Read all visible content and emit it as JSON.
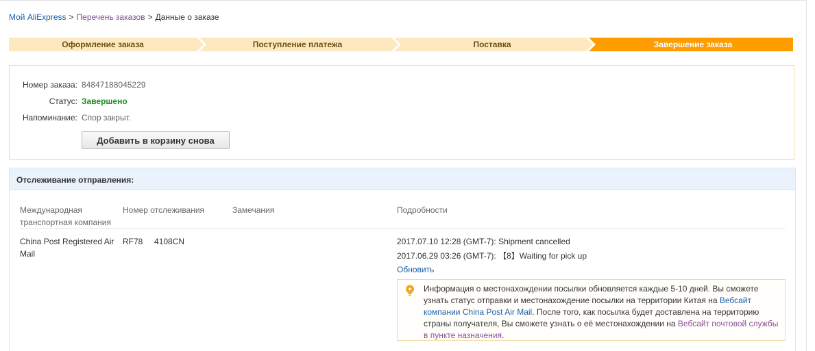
{
  "breadcrumb": {
    "home": "Мой AliExpress",
    "orders": "Перечень заказов",
    "current": "Данные о заказе",
    "separator": ">"
  },
  "steps": [
    {
      "label": "Оформление заказа",
      "active": false
    },
    {
      "label": "Поступление платежа",
      "active": false
    },
    {
      "label": "Поставка",
      "active": false
    },
    {
      "label": "Завершение заказа",
      "active": true
    }
  ],
  "colors": {
    "step_inactive": "#fde8bf",
    "step_active": "#ff9c00",
    "status_green": "#1a8e1f",
    "link_blue": "#1a5ea8",
    "link_purple": "#8a4f9b"
  },
  "order": {
    "number_label": "Номер заказа:",
    "number_value": "84847188045229",
    "status_label": "Статус:",
    "status_value": "Завершено",
    "reminder_label": "Напоминание:",
    "reminder_value": "Спор закрыт.",
    "add_to_cart_label": "Добавить в корзину снова"
  },
  "tracking": {
    "title": "Отслеживание отправления:",
    "columns": {
      "carrier_line1": "Международная",
      "carrier_line2": "транспортная компания",
      "tracking_number": "Номер отслеживания",
      "remarks": "Замечания",
      "details": "Подробности"
    },
    "row": {
      "carrier_line1": "China Post Registered Air",
      "carrier_line2": "Mail",
      "tracking_number": "RF78     4108CN",
      "remarks": "",
      "events": [
        "2017.07.10 12:28 (GMT-7): Shipment cancelled",
        "2017.06.29 03:26 (GMT-7): 【8】Waiting for pick up"
      ],
      "refresh_label": "Обновить"
    },
    "notice": {
      "icon": "lightbulb-icon",
      "part1": "Информация о местонахождении посылки обновляется каждые 5-10 дней. Вы сможете узнать статус отправки и местонахождение посылки на территории Китая на ",
      "link1": "Вебсайт компании China Post Air Mail",
      "part2": ". После того, как посылка будет доставлена на территорию страны получателя, Вы сможете узнать о её местонахождении на ",
      "link2": "Вебсайт почтовой службы в пункте назначения",
      "part3": "."
    }
  }
}
